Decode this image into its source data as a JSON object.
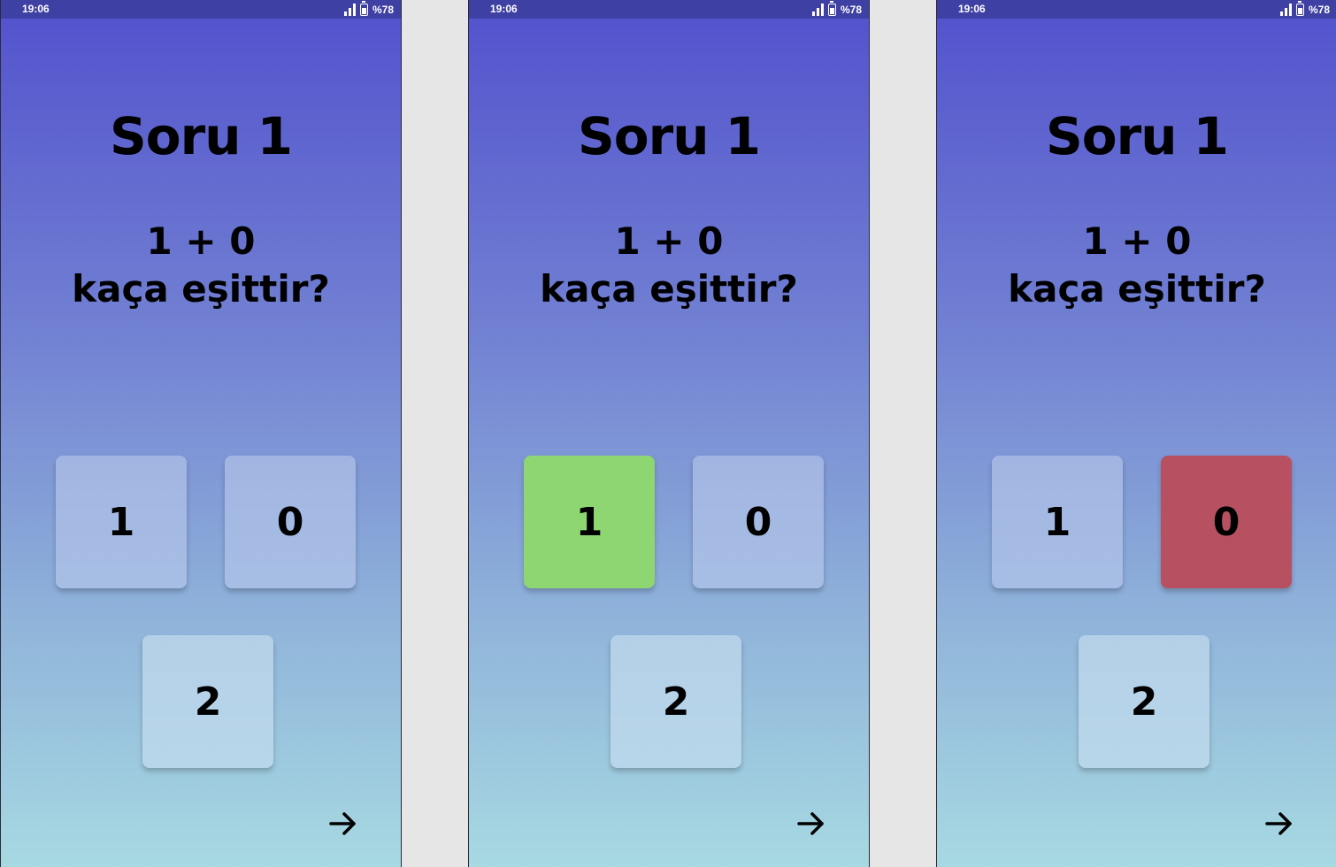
{
  "screens": [
    {
      "status": {
        "time": "19:06",
        "battery": "%78"
      },
      "title": "Soru 1",
      "equation": "1 + 0",
      "prompt": "kaça eşittir?",
      "answers": [
        {
          "label": "1",
          "state": "default"
        },
        {
          "label": "0",
          "state": "default"
        },
        {
          "label": "2",
          "state": "default"
        }
      ],
      "next_icon": "arrow-right-icon"
    },
    {
      "status": {
        "time": "19:06",
        "battery": "%78"
      },
      "title": "Soru 1",
      "equation": "1 + 0",
      "prompt": "kaça eşittir?",
      "answers": [
        {
          "label": "1",
          "state": "correct"
        },
        {
          "label": "0",
          "state": "default"
        },
        {
          "label": "2",
          "state": "default"
        }
      ],
      "next_icon": "arrow-right-icon"
    },
    {
      "status": {
        "time": "19:06",
        "battery": "%78"
      },
      "title": "Soru 1",
      "equation": "1 + 0",
      "prompt": "kaça eşittir?",
      "answers": [
        {
          "label": "1",
          "state": "default"
        },
        {
          "label": "0",
          "state": "wrong"
        },
        {
          "label": "2",
          "state": "default"
        }
      ],
      "next_icon": "arrow-right-icon"
    }
  ],
  "colors": {
    "gradient_top": "#5251cd",
    "gradient_bottom": "#a7d9e2",
    "status_bar": "#3f40a3",
    "correct": "#8ed672",
    "wrong": "#b75162",
    "button_default": "#a4b6e4"
  }
}
